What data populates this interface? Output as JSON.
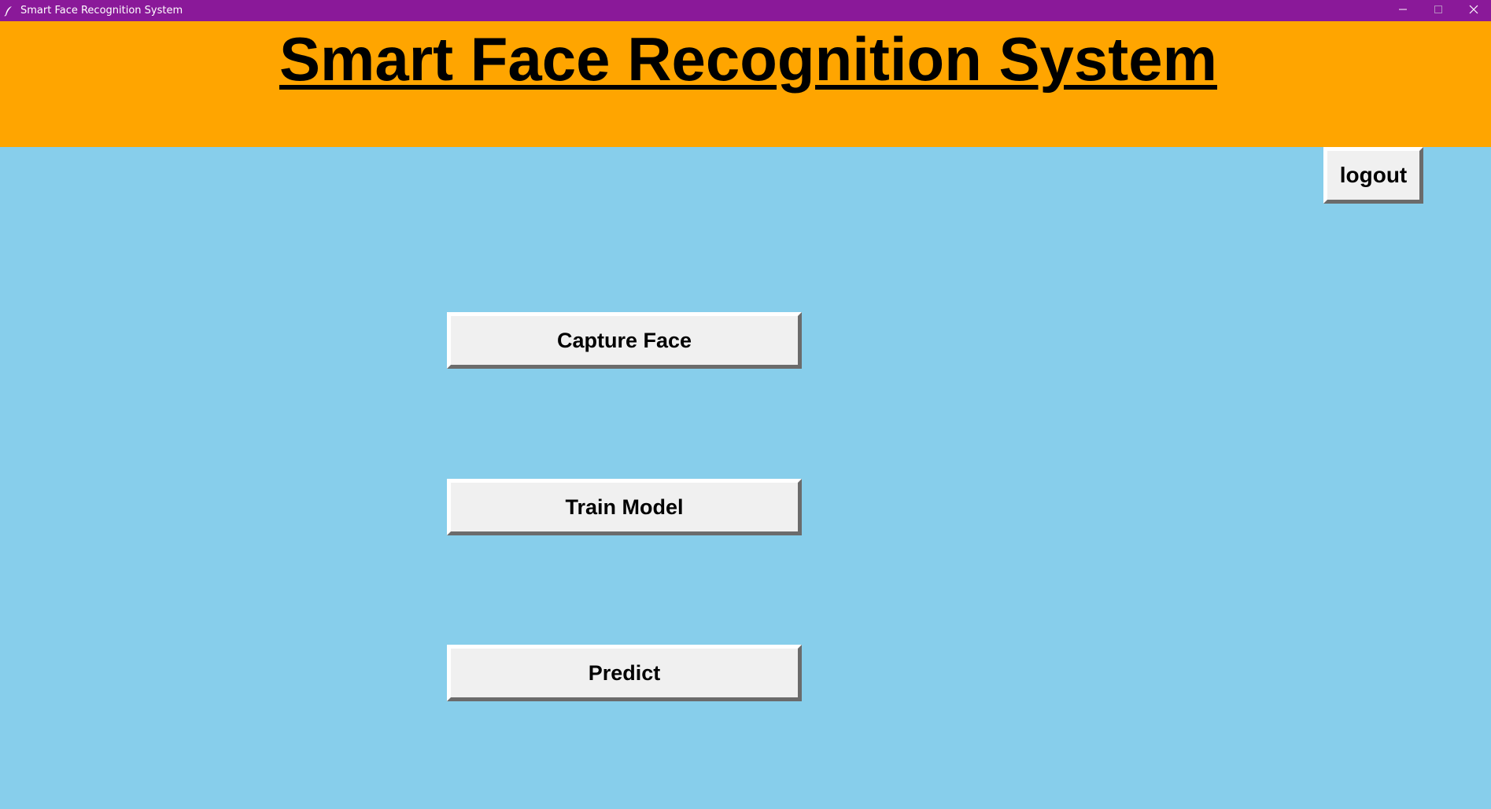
{
  "window": {
    "title": "Smart Face Recognition System",
    "titlebar_color": "#8A1999",
    "controls": {
      "minimize_icon": "minimize-icon",
      "maximize_icon": "maximize-icon",
      "close_icon": "close-icon"
    }
  },
  "header": {
    "title": "Smart Face Recognition System",
    "background": "#FFA500"
  },
  "main": {
    "background": "#87CEEB",
    "logout_label": "logout",
    "buttons": [
      {
        "label": "Capture Face"
      },
      {
        "label": "Train Model"
      },
      {
        "label": "Predict"
      }
    ]
  }
}
